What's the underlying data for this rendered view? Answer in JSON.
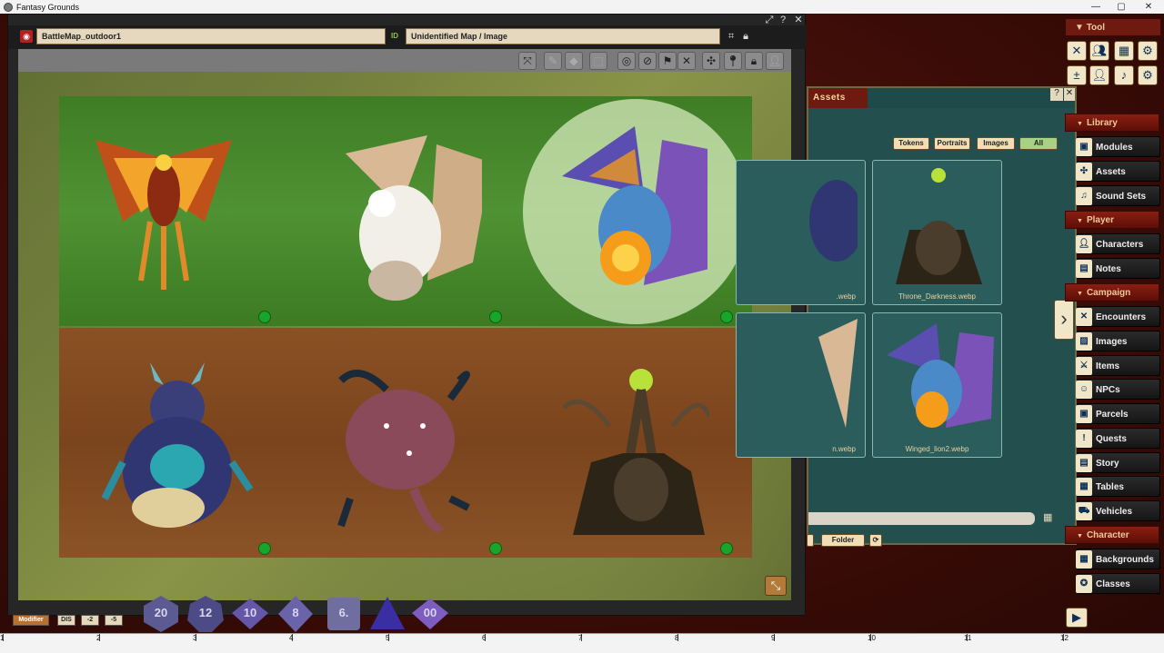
{
  "app": {
    "title": "Fantasy Grounds"
  },
  "image_window": {
    "name_field": "BattleMap_outdoor1",
    "id_label": "ID",
    "type_field": "Unidentified Map / Image"
  },
  "assets": {
    "title": "Assets",
    "filters": [
      "Tokens",
      "Portraits",
      "Images",
      "All"
    ],
    "active_filter": "All",
    "items": [
      {
        "caption": ".webp"
      },
      {
        "caption": "Throne_Darkness.webp"
      },
      {
        "caption": "n.webp"
      },
      {
        "caption": "Winged_lion2.webp"
      }
    ],
    "folder_label": "Folder"
  },
  "sidebar": {
    "tool_header": "Tool",
    "sections": [
      {
        "label": "Library",
        "items": [
          "Modules",
          "Assets",
          "Sound Sets"
        ]
      },
      {
        "label": "Player",
        "items": [
          "Characters",
          "Notes"
        ]
      },
      {
        "label": "Campaign",
        "items": [
          "Encounters",
          "Images",
          "Items",
          "NPCs",
          "Parcels",
          "Quests",
          "Story",
          "Tables",
          "Vehicles"
        ]
      },
      {
        "label": "Character",
        "items": [
          "Backgrounds",
          "Classes"
        ]
      }
    ]
  },
  "dice": [
    "20",
    "12",
    "10",
    "8",
    "6.",
    "",
    "00"
  ],
  "modifiers": [
    "Modifier",
    "DIS",
    "-2",
    "-5"
  ],
  "ruler": [
    "1",
    "2",
    "3",
    "4",
    "5",
    "6",
    "7",
    "8",
    "9",
    "10",
    "11",
    "12"
  ],
  "colors": {
    "accent": "#6e1a10",
    "panel": "#23504f",
    "token_dot": "#19a52a"
  }
}
